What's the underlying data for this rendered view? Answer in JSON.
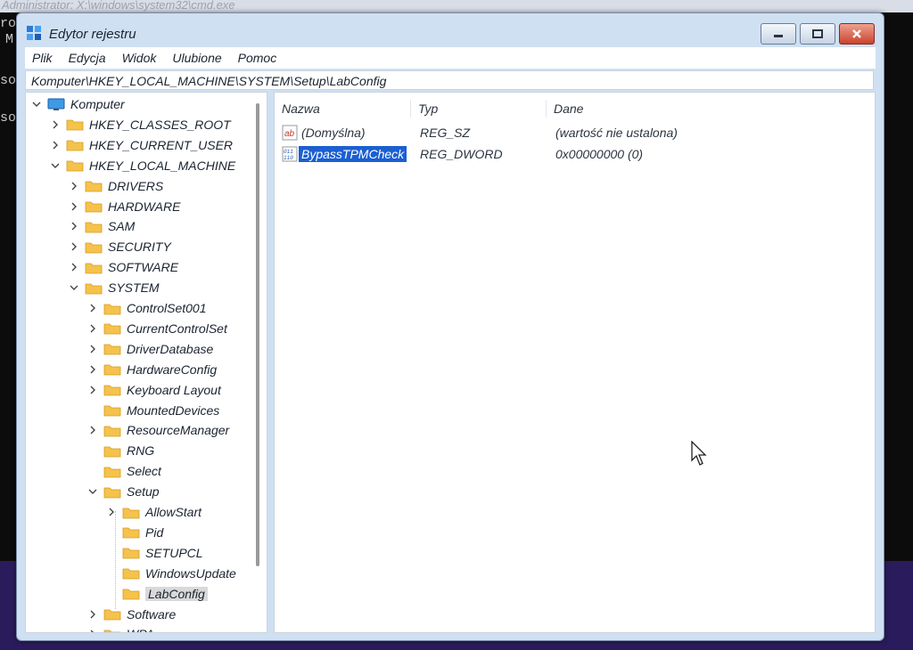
{
  "background": {
    "cmd_title": "Administrator: X:\\windows\\system32\\cmd.exe",
    "cmd_lines": [
      "ro",
      "M",
      "so",
      "so"
    ]
  },
  "window": {
    "title": "Edytor rejestru",
    "controls": {
      "minimize": "minimize",
      "maximize": "maximize",
      "close": "close"
    }
  },
  "menu": [
    "Plik",
    "Edycja",
    "Widok",
    "Ulubione",
    "Pomoc"
  ],
  "address": "Komputer\\HKEY_LOCAL_MACHINE\\SYSTEM\\Setup\\LabConfig",
  "tree": [
    {
      "label": "Komputer",
      "level": 0,
      "expanded": true,
      "hasChildren": true,
      "icon": "computer-icon"
    },
    {
      "label": "HKEY_CLASSES_ROOT",
      "level": 1,
      "expanded": false,
      "hasChildren": true
    },
    {
      "label": "HKEY_CURRENT_USER",
      "level": 1,
      "expanded": false,
      "hasChildren": true
    },
    {
      "label": "HKEY_LOCAL_MACHINE",
      "level": 1,
      "expanded": true,
      "hasChildren": true
    },
    {
      "label": "DRIVERS",
      "level": 2,
      "expanded": false,
      "hasChildren": true
    },
    {
      "label": "HARDWARE",
      "level": 2,
      "expanded": false,
      "hasChildren": true
    },
    {
      "label": "SAM",
      "level": 2,
      "expanded": false,
      "hasChildren": true
    },
    {
      "label": "SECURITY",
      "level": 2,
      "expanded": false,
      "hasChildren": true
    },
    {
      "label": "SOFTWARE",
      "level": 2,
      "expanded": false,
      "hasChildren": true
    },
    {
      "label": "SYSTEM",
      "level": 2,
      "expanded": true,
      "hasChildren": true
    },
    {
      "label": "ControlSet001",
      "level": 3,
      "expanded": false,
      "hasChildren": true
    },
    {
      "label": "CurrentControlSet",
      "level": 3,
      "expanded": false,
      "hasChildren": true
    },
    {
      "label": "DriverDatabase",
      "level": 3,
      "expanded": false,
      "hasChildren": true
    },
    {
      "label": "HardwareConfig",
      "level": 3,
      "expanded": false,
      "hasChildren": true
    },
    {
      "label": "Keyboard Layout",
      "level": 3,
      "expanded": false,
      "hasChildren": true
    },
    {
      "label": "MountedDevices",
      "level": 3,
      "expanded": false,
      "hasChildren": false
    },
    {
      "label": "ResourceManager",
      "level": 3,
      "expanded": false,
      "hasChildren": true
    },
    {
      "label": "RNG",
      "level": 3,
      "expanded": false,
      "hasChildren": false
    },
    {
      "label": "Select",
      "level": 3,
      "expanded": false,
      "hasChildren": false
    },
    {
      "label": "Setup",
      "level": 3,
      "expanded": true,
      "hasChildren": true
    },
    {
      "label": "AllowStart",
      "level": 4,
      "expanded": false,
      "hasChildren": true
    },
    {
      "label": "Pid",
      "level": 4,
      "expanded": false,
      "hasChildren": false
    },
    {
      "label": "SETUPCL",
      "level": 4,
      "expanded": false,
      "hasChildren": false
    },
    {
      "label": "WindowsUpdate",
      "level": 4,
      "expanded": false,
      "hasChildren": false
    },
    {
      "label": "LabConfig",
      "level": 4,
      "expanded": false,
      "hasChildren": false,
      "selected": true
    },
    {
      "label": "Software",
      "level": 3,
      "expanded": false,
      "hasChildren": true
    },
    {
      "label": "WPA",
      "level": 3,
      "expanded": false,
      "hasChildren": true
    }
  ],
  "columns": {
    "name": "Nazwa",
    "type": "Typ",
    "data": "Dane"
  },
  "values": [
    {
      "name": "(Domyślna)",
      "type": "REG_SZ",
      "data": "(wartość nie ustalona)",
      "icon": "string-value-icon",
      "selected": false
    },
    {
      "name": "BypassTPMCheck",
      "type": "REG_DWORD",
      "data": "0x00000000 (0)",
      "icon": "binary-value-icon",
      "selected": true
    }
  ]
}
